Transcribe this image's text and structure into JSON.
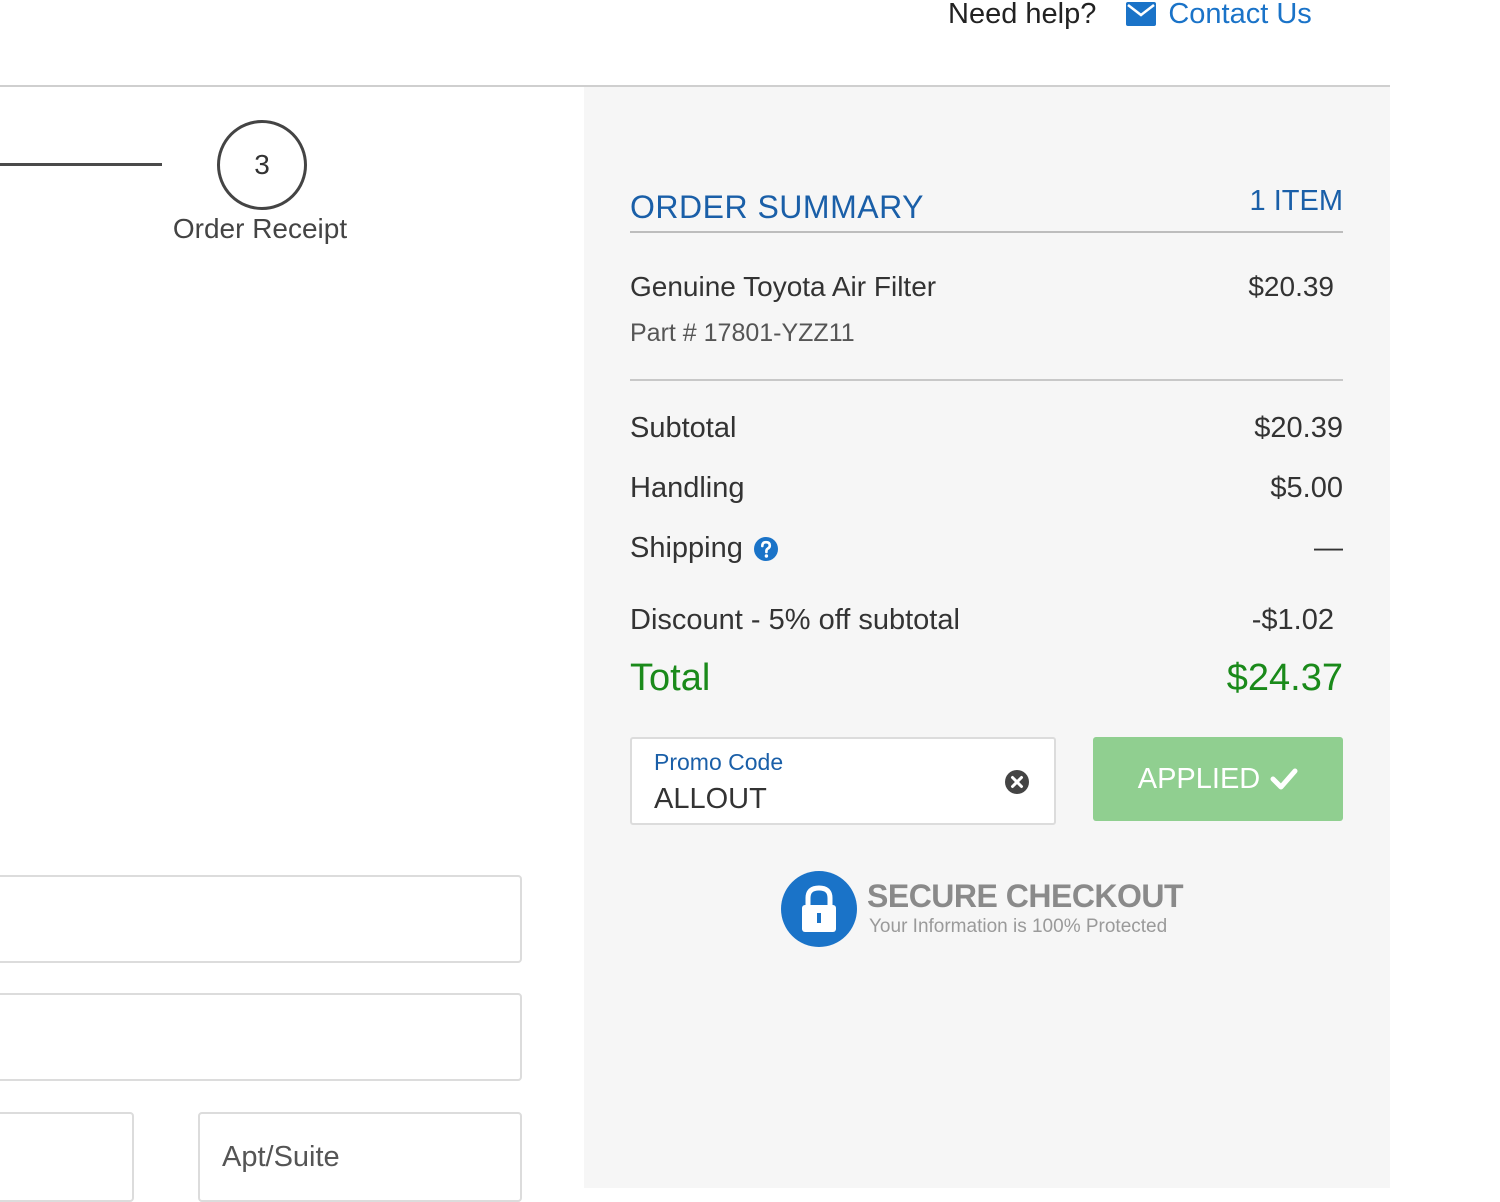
{
  "header": {
    "help_label": "Need help?",
    "contact_label": "Contact Us",
    "contact_icon": "envelope-icon",
    "link_color": "#1a73c8"
  },
  "progress": {
    "step_number": "3",
    "step_label": "Order Receipt"
  },
  "form": {
    "apt_placeholder": "Apt/Suite"
  },
  "order_summary": {
    "title": "ORDER SUMMARY",
    "item_count": "1 ITEM",
    "items": [
      {
        "name": "Genuine Toyota Air Filter",
        "price": "$20.39",
        "part": "Part # 17801-YZZ11"
      }
    ],
    "subtotal_label": "Subtotal",
    "subtotal_value": "$20.39",
    "handling_label": "Handling",
    "handling_value": "$5.00",
    "shipping_label": "Shipping",
    "shipping_value": "—",
    "shipping_help_icon": "question-circle-icon",
    "discount_label": "Discount - 5% off subtotal",
    "discount_value": "-$1.02",
    "total_label": "Total",
    "total_value": "$24.37",
    "total_color": "#1a8a1a",
    "accent_color": "#1a5fa8"
  },
  "promo": {
    "label": "Promo Code",
    "value": "ALLOUT",
    "button_label": "APPLIED",
    "button_color": "#90cf90",
    "clear_icon": "clear-circle-icon",
    "check_icon": "check-icon"
  },
  "secure": {
    "title": "SECURE CHECKOUT",
    "subtitle": "Your Information is 100% Protected",
    "icon": "lock-icon",
    "icon_color": "#1a73c8"
  }
}
